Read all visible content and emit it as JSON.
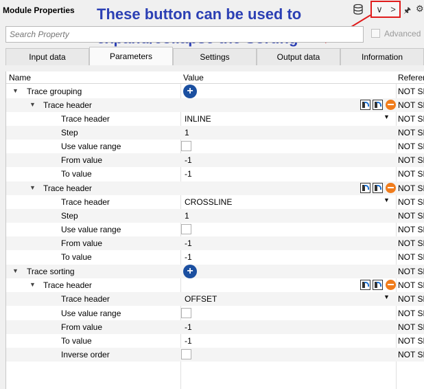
{
  "window": {
    "title": "Module Properties"
  },
  "annotation": {
    "line1": "These button can be used to",
    "line2": "expand/collapse the Sorting"
  },
  "toolbar": {
    "collapse_label": "∨",
    "expand_label": ">"
  },
  "search": {
    "placeholder": "Search Property",
    "advanced_label": "Advanced"
  },
  "tabs": [
    {
      "label": "Input data",
      "active": false
    },
    {
      "label": "Parameters",
      "active": true
    },
    {
      "label": "Settings",
      "active": false
    },
    {
      "label": "Output data",
      "active": false
    },
    {
      "label": "Information",
      "active": false
    }
  ],
  "columns": {
    "name": "Name",
    "value": "Value",
    "reference": "Referen"
  },
  "rows": [
    {
      "name": "Trace grouping",
      "value": "",
      "ref": "NOT SET"
    },
    {
      "name": "Trace header",
      "value": "",
      "ref": "NOT SET"
    },
    {
      "name": "Trace header",
      "value": "INLINE",
      "ref": "NOT SET"
    },
    {
      "name": "Step",
      "value": "1",
      "ref": "NOT SET"
    },
    {
      "name": "Use value range",
      "value": "",
      "ref": "NOT SET"
    },
    {
      "name": "From value",
      "value": "-1",
      "ref": "NOT SET"
    },
    {
      "name": "To value",
      "value": "-1",
      "ref": "NOT SET"
    },
    {
      "name": "Trace header",
      "value": "",
      "ref": "NOT SET"
    },
    {
      "name": "Trace header",
      "value": "CROSSLINE",
      "ref": "NOT SET"
    },
    {
      "name": "Step",
      "value": "1",
      "ref": "NOT SET"
    },
    {
      "name": "Use value range",
      "value": "",
      "ref": "NOT SET"
    },
    {
      "name": "From value",
      "value": "-1",
      "ref": "NOT SET"
    },
    {
      "name": "To value",
      "value": "-1",
      "ref": "NOT SET"
    },
    {
      "name": "Trace sorting",
      "value": "",
      "ref": "NOT SET"
    },
    {
      "name": "Trace header",
      "value": "",
      "ref": "NOT SET"
    },
    {
      "name": "Trace header",
      "value": "OFFSET",
      "ref": "NOT SET"
    },
    {
      "name": "Use value range",
      "value": "",
      "ref": "NOT SET"
    },
    {
      "name": "From value",
      "value": "-1",
      "ref": "NOT SET"
    },
    {
      "name": "To value",
      "value": "-1",
      "ref": "NOT SET"
    },
    {
      "name": "Inverse order",
      "value": "",
      "ref": "NOT SET"
    }
  ]
}
